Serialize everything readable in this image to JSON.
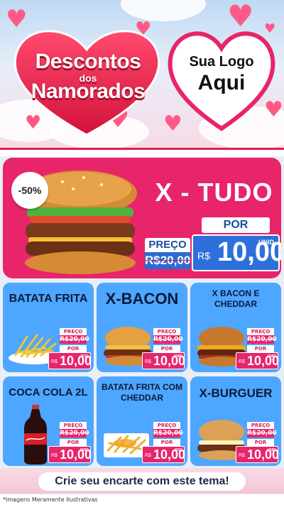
{
  "header": {
    "title_line1": "Descontos",
    "title_line2": "dos",
    "title_line3": "Namorados",
    "logo_line1": "Sua Logo",
    "logo_line2": "Aqui"
  },
  "featured": {
    "discount": "-50%",
    "name": "X - TUDO",
    "preco_label": "PREÇO",
    "old_price": "R$20,00",
    "por_label": "POR",
    "currency": "R$",
    "new_price": "10,00",
    "unit": "UNID"
  },
  "cards": [
    {
      "name": "BATATA FRITA",
      "preco_label": "PREÇO",
      "old_price": "R$20,00",
      "por_label": "POR",
      "currency": "R$",
      "price": "10,00",
      "unit": "POÇ",
      "icon": "fries-icon"
    },
    {
      "name": "X-BACON",
      "preco_label": "PREÇO",
      "old_price": "R$20,00",
      "por_label": "POR",
      "currency": "R$",
      "price": "10,00",
      "unit": "UNID",
      "icon": "burger-icon"
    },
    {
      "name": "X BACON E CHEDDAR",
      "preco_label": "PREÇO",
      "old_price": "R$20,00",
      "por_label": "POR",
      "currency": "R$",
      "price": "10,00",
      "unit": "UNID",
      "icon": "burger-icon"
    },
    {
      "name": "COCA COLA 2L",
      "preco_label": "PREÇO",
      "old_price": "R$20,00",
      "por_label": "POR",
      "currency": "R$",
      "price": "10,00",
      "unit": "UNID",
      "icon": "soda-bottle-icon"
    },
    {
      "name": "BATATA FRITA COM CHEDDAR",
      "preco_label": "PREÇO",
      "old_price": "R$20,00",
      "por_label": "POR",
      "currency": "R$",
      "price": "10,00",
      "unit": "POÇ",
      "icon": "fries-cheddar-icon"
    },
    {
      "name": "X-BURGUER",
      "preco_label": "PREÇO",
      "old_price": "R$20,00",
      "por_label": "POR",
      "currency": "R$",
      "price": "10,00",
      "unit": "UNID",
      "icon": "burger-icon"
    }
  ],
  "footer": {
    "cta": "Crie seu encarte com este tema!",
    "disclaimer": "*Imagens Meramente Ilustrativas"
  },
  "colors": {
    "primary_pink": "#e8246a",
    "card_blue": "#4da6ff",
    "price_blue": "#2d6fdb",
    "header_red": "#e01d4c"
  }
}
